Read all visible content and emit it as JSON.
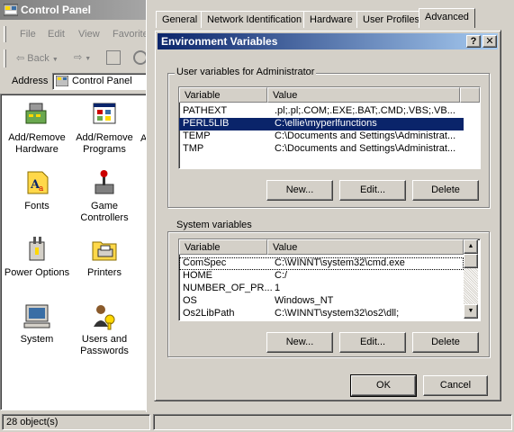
{
  "control_panel": {
    "title": "Control Panel",
    "menu": [
      "File",
      "Edit",
      "View",
      "Favorite"
    ],
    "toolbar": {
      "back_label": "Back"
    },
    "address": {
      "label": "Address",
      "value": "Control Panel"
    },
    "items": [
      {
        "label": "Add/Remove Hardware",
        "icon": "add-remove-hardware-icon"
      },
      {
        "label": "Add/Remove Programs",
        "icon": "add-remove-programs-icon"
      },
      {
        "label": "Fonts",
        "icon": "fonts-icon"
      },
      {
        "label": "Game Controllers",
        "icon": "game-controllers-icon"
      },
      {
        "label": "Power Options",
        "icon": "power-options-icon"
      },
      {
        "label": "Printers",
        "icon": "printers-icon"
      },
      {
        "label": "System",
        "icon": "system-icon"
      },
      {
        "label": "Users and Passwords",
        "icon": "users-passwords-icon"
      }
    ],
    "status": "28 object(s)",
    "partial_column_letter": "A"
  },
  "system_properties": {
    "tabs": [
      "General",
      "Network Identification",
      "Hardware",
      "User Profiles",
      "Advanced"
    ],
    "active_tab": "Advanced"
  },
  "env_dialog": {
    "title": "Environment Variables",
    "help_button": "?",
    "close_button": "✕",
    "user_group_label": "User variables for Administrator",
    "system_group_label": "System variables",
    "columns": [
      "Variable",
      "Value"
    ],
    "user_vars": [
      {
        "name": "PATHEXT",
        "value": ".pl;.pl;.COM;.EXE;.BAT;.CMD;.VBS;.VB..."
      },
      {
        "name": "PERL5LIB",
        "value": "C:\\ellie\\myperlfunctions",
        "selected": true
      },
      {
        "name": "TEMP",
        "value": "C:\\Documents and Settings\\Administrat..."
      },
      {
        "name": "TMP",
        "value": "C:\\Documents and Settings\\Administrat..."
      }
    ],
    "system_vars": [
      {
        "name": "ComSpec",
        "value": "C:\\WINNT\\system32\\cmd.exe"
      },
      {
        "name": "HOME",
        "value": "C:/"
      },
      {
        "name": "NUMBER_OF_PR...",
        "value": "1"
      },
      {
        "name": "OS",
        "value": "Windows_NT"
      },
      {
        "name": "Os2LibPath",
        "value": "C:\\WINNT\\system32\\os2\\dll;"
      }
    ],
    "buttons": {
      "new": "New...",
      "edit": "Edit...",
      "delete": "Delete",
      "ok": "OK",
      "cancel": "Cancel"
    },
    "colors": {
      "title_active": "#0a246a",
      "title_gradient_end": "#a6caf0",
      "selection": "#0a246a"
    }
  }
}
